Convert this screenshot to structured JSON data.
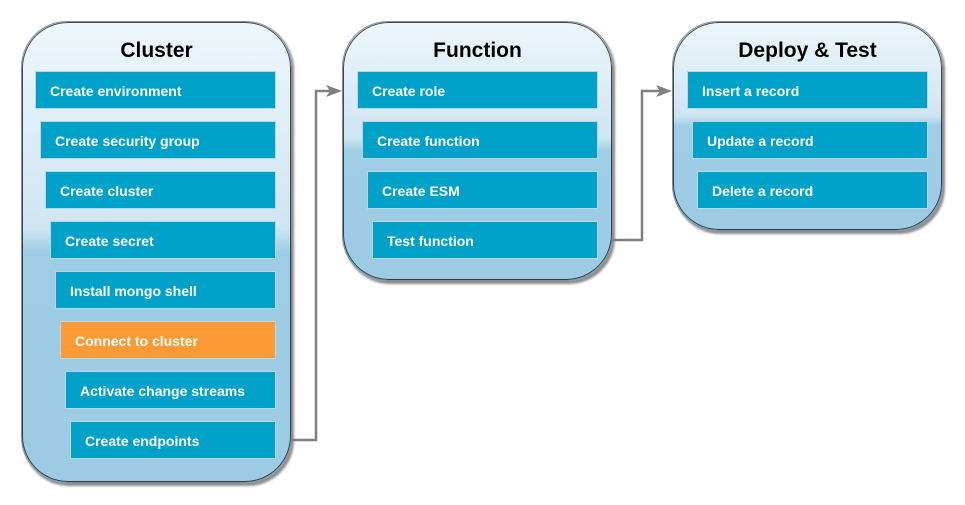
{
  "groups": [
    {
      "title": "Cluster",
      "steps": [
        {
          "label": "Create environment",
          "active": false
        },
        {
          "label": "Create security group",
          "active": false
        },
        {
          "label": "Create cluster",
          "active": false
        },
        {
          "label": "Create secret",
          "active": false
        },
        {
          "label": "Install mongo shell",
          "active": false
        },
        {
          "label": "Connect to cluster",
          "active": true
        },
        {
          "label": "Activate change streams",
          "active": false
        },
        {
          "label": "Create endpoints",
          "active": false
        }
      ]
    },
    {
      "title": "Function",
      "steps": [
        {
          "label": "Create role",
          "active": false
        },
        {
          "label": "Create function",
          "active": false
        },
        {
          "label": "Create ESM",
          "active": false
        },
        {
          "label": "Test function",
          "active": false
        }
      ]
    },
    {
      "title": "Deploy & Test",
      "steps": [
        {
          "label": "Insert a record",
          "active": false
        },
        {
          "label": "Update a record",
          "active": false
        },
        {
          "label": "Delete a record",
          "active": false
        }
      ]
    }
  ],
  "colors": {
    "step": "#00a1c9",
    "active_step": "#fe9a35",
    "connector": "#808080"
  }
}
